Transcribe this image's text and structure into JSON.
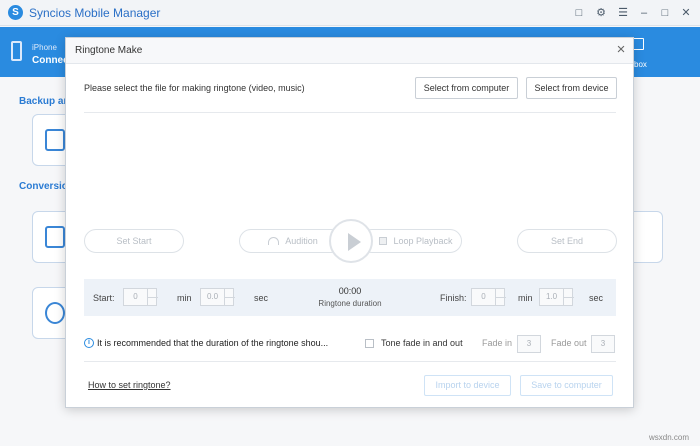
{
  "app": {
    "title": "Syncios Mobile Manager",
    "logo_letter": "S",
    "accent_color": "#2a8be0",
    "window_controls": [
      "feedback-icon",
      "gear-icon",
      "menu-icon",
      "minimize-icon",
      "maximize-icon",
      "close-icon"
    ]
  },
  "nav": {
    "device_name": "iPhone",
    "device_status": "Connect",
    "toolbox_label": "box"
  },
  "background": {
    "section_backup": "Backup an",
    "section_conversion": "Conversion"
  },
  "dialog": {
    "title": "Ringtone Make",
    "prompt": "Please select the file for making ringtone (video, music)",
    "select_computer": "Select from computer",
    "select_device": "Select from device",
    "set_start": "Set Start",
    "audition": "Audition",
    "loop_playback": "Loop Playback",
    "set_end": "Set End",
    "start_label": "Start:",
    "start_min": "0",
    "min_unit": "min",
    "start_sec": "0.0",
    "sec_unit": "sec",
    "duration_value": "00:00",
    "duration_label": "Ringtone duration",
    "finish_label": "Finish:",
    "finish_min": "0",
    "finish_sec": "1.0",
    "info_text": "It is recommended that the duration of the ringtone shou...",
    "tone_fade": "Tone fade in and out",
    "fade_in_label": "Fade in",
    "fade_in_value": "3",
    "fade_out_label": "Fade out",
    "fade_out_value": "3",
    "help_link": "How to set ringtone?",
    "import_button": "Import to device",
    "save_button": "Save to computer"
  },
  "watermark": "wsxdn.com"
}
